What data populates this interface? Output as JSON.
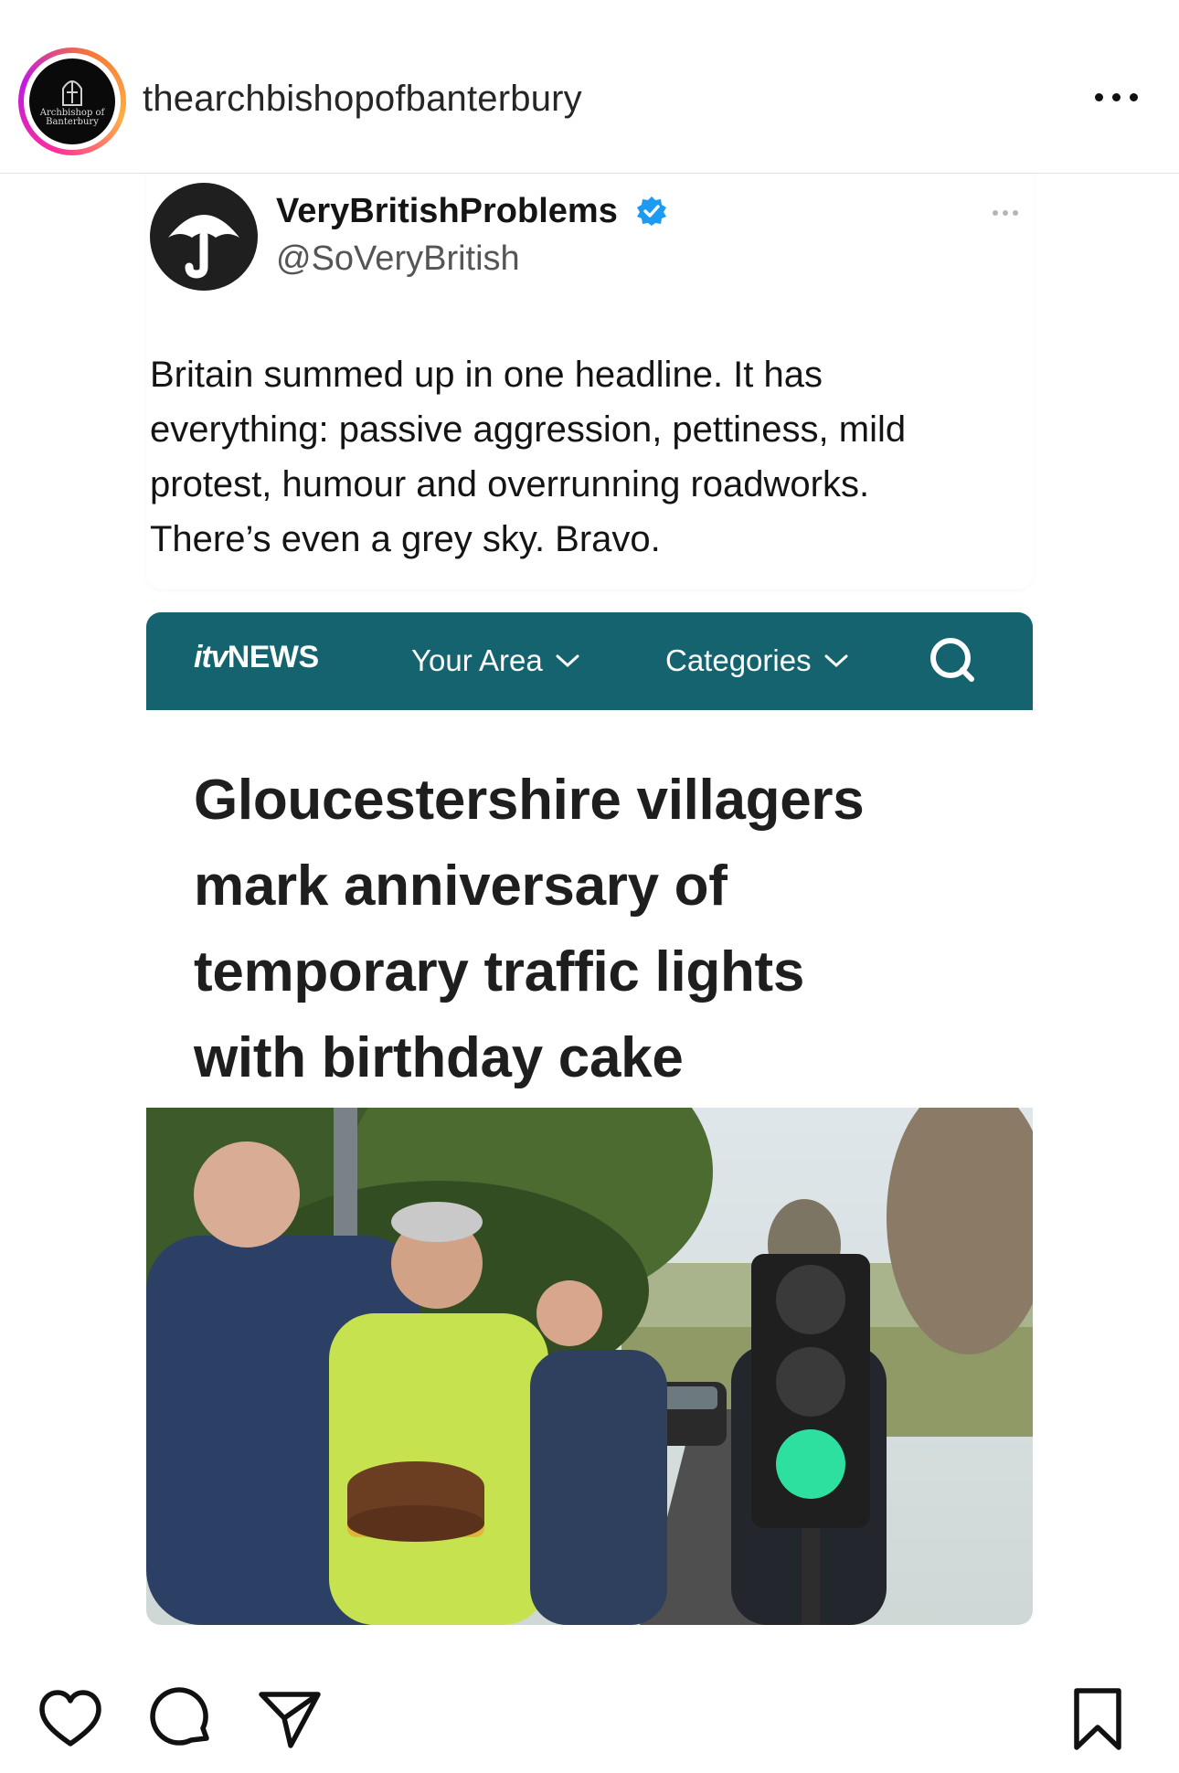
{
  "post": {
    "username": "thearchbishopofbanterbury",
    "avatar_text": "Archbishop of Banterbury"
  },
  "tweet": {
    "display_name": "VeryBritishProblems",
    "handle": "@SoVeryBritish",
    "verified": true,
    "text_lines": [
      "Britain summed up in one headline. It has",
      "everything: passive aggression, pettiness, mild",
      "protest, humour and overrunning roadworks.",
      "There’s even a grey sky. Bravo."
    ]
  },
  "itv": {
    "logo_itv": "itv",
    "logo_news": "NEWS",
    "nav": [
      "Your Area",
      "Categories"
    ],
    "brand_color": "#14636f",
    "headline_lines": [
      "Gloucestershire villagers",
      "mark anniversary of",
      "temporary traffic lights",
      "with birthday cake"
    ]
  },
  "icons": {
    "like": "heart-icon",
    "comment": "comment-icon",
    "share": "send-icon",
    "save": "bookmark-icon",
    "more": "more-options-icon",
    "search": "search-icon"
  }
}
